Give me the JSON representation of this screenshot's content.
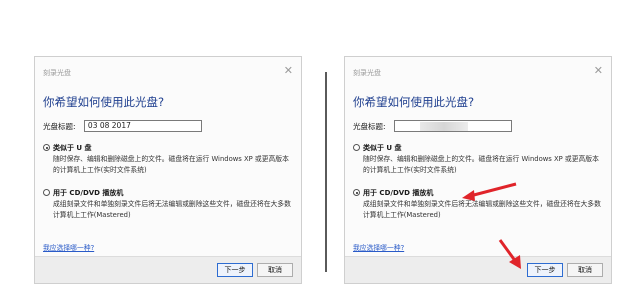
{
  "dialogs": [
    {
      "window_title": "刻录光盘",
      "heading": "你希望如何使用此光盘?",
      "disc_title_label": "光盘标题:",
      "disc_title_value": "03 08 2017",
      "option1_title": "类似于 U 盘",
      "option1_desc": "随时保存、编辑和删除磁盘上的文件。磁盘将在运行 Windows XP 或更高版本的计算机上工作(实时文件系统)",
      "option2_title": "用于 CD/DVD 播放机",
      "option2_desc": "成组刻录文件和单独刻录文件后将无法编辑或删除这些文件，磁盘还将在大多数计算机上工作(Mastered)",
      "help_link": "我应选择哪一种?",
      "next_button": "下一步",
      "cancel_button": "取消",
      "selected_option": "option1"
    },
    {
      "window_title": "刻录光盘",
      "heading": "你希望如何使用此光盘?",
      "disc_title_label": "光盘标题:",
      "disc_title_value": "",
      "option1_title": "类似于 U 盘",
      "option1_desc": "随时保存、编辑和删除磁盘上的文件。磁盘将在运行 Windows XP 或更高版本的计算机上工作(实时文件系统)",
      "option2_title": "用于 CD/DVD 播放机",
      "option2_desc": "成组刻录文件和单独刻录文件后将无法编辑或删除这些文件，磁盘还将在大多数计算机上工作(Mastered)",
      "help_link": "我应选择哪一种?",
      "next_button": "下一步",
      "cancel_button": "取消",
      "selected_option": "option2"
    }
  ],
  "colors": {
    "heading": "#1f3f8f",
    "link": "#2a5bc8",
    "annotation_arrow": "#e0242a"
  }
}
